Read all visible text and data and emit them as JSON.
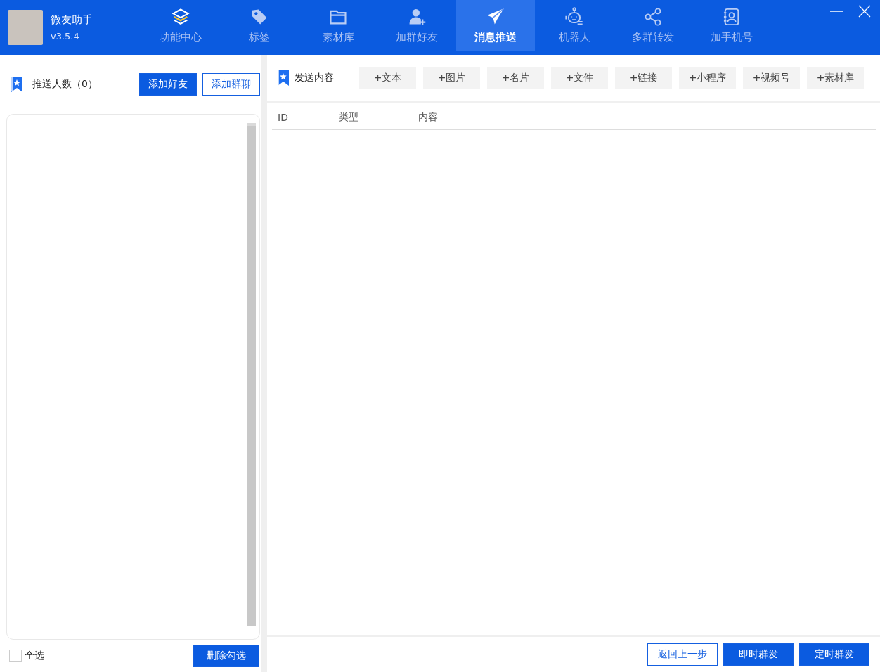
{
  "app": {
    "name": "微友助手",
    "version": "v3.5.4"
  },
  "nav": [
    {
      "label": "功能中心",
      "kind": "layers",
      "selected": false
    },
    {
      "label": "标签",
      "kind": "tag",
      "selected": false
    },
    {
      "label": "素材库",
      "kind": "folder",
      "selected": false
    },
    {
      "label": "加群好友",
      "kind": "useradd",
      "selected": false
    },
    {
      "label": "消息推送",
      "kind": "send",
      "selected": true
    },
    {
      "label": "机器人",
      "kind": "robot",
      "selected": false
    },
    {
      "label": "多群转发",
      "kind": "share",
      "selected": false
    },
    {
      "label": "加手机号",
      "kind": "contacts",
      "selected": false
    }
  ],
  "recipients": {
    "title": "推送人数（0）",
    "buttons": [
      {
        "label": "添加好友",
        "kind": "primary"
      },
      {
        "label": "添加群聊",
        "kind": "outline"
      }
    ],
    "select_all": {
      "label": "全选",
      "checked": false
    },
    "delete_button": "删除勾选"
  },
  "content": {
    "title": "发送内容",
    "add_buttons": [
      "+文本",
      "+图片",
      "+名片",
      "+文件",
      "+链接",
      "+小程序",
      "+视频号",
      "+素材库"
    ],
    "columns": [
      "ID",
      "类型",
      "内容"
    ],
    "footer_buttons": [
      {
        "label": "返回上一步",
        "kind": "outline"
      },
      {
        "label": "即时群发",
        "kind": "primary"
      },
      {
        "label": "定时群发",
        "kind": "primary"
      }
    ]
  }
}
